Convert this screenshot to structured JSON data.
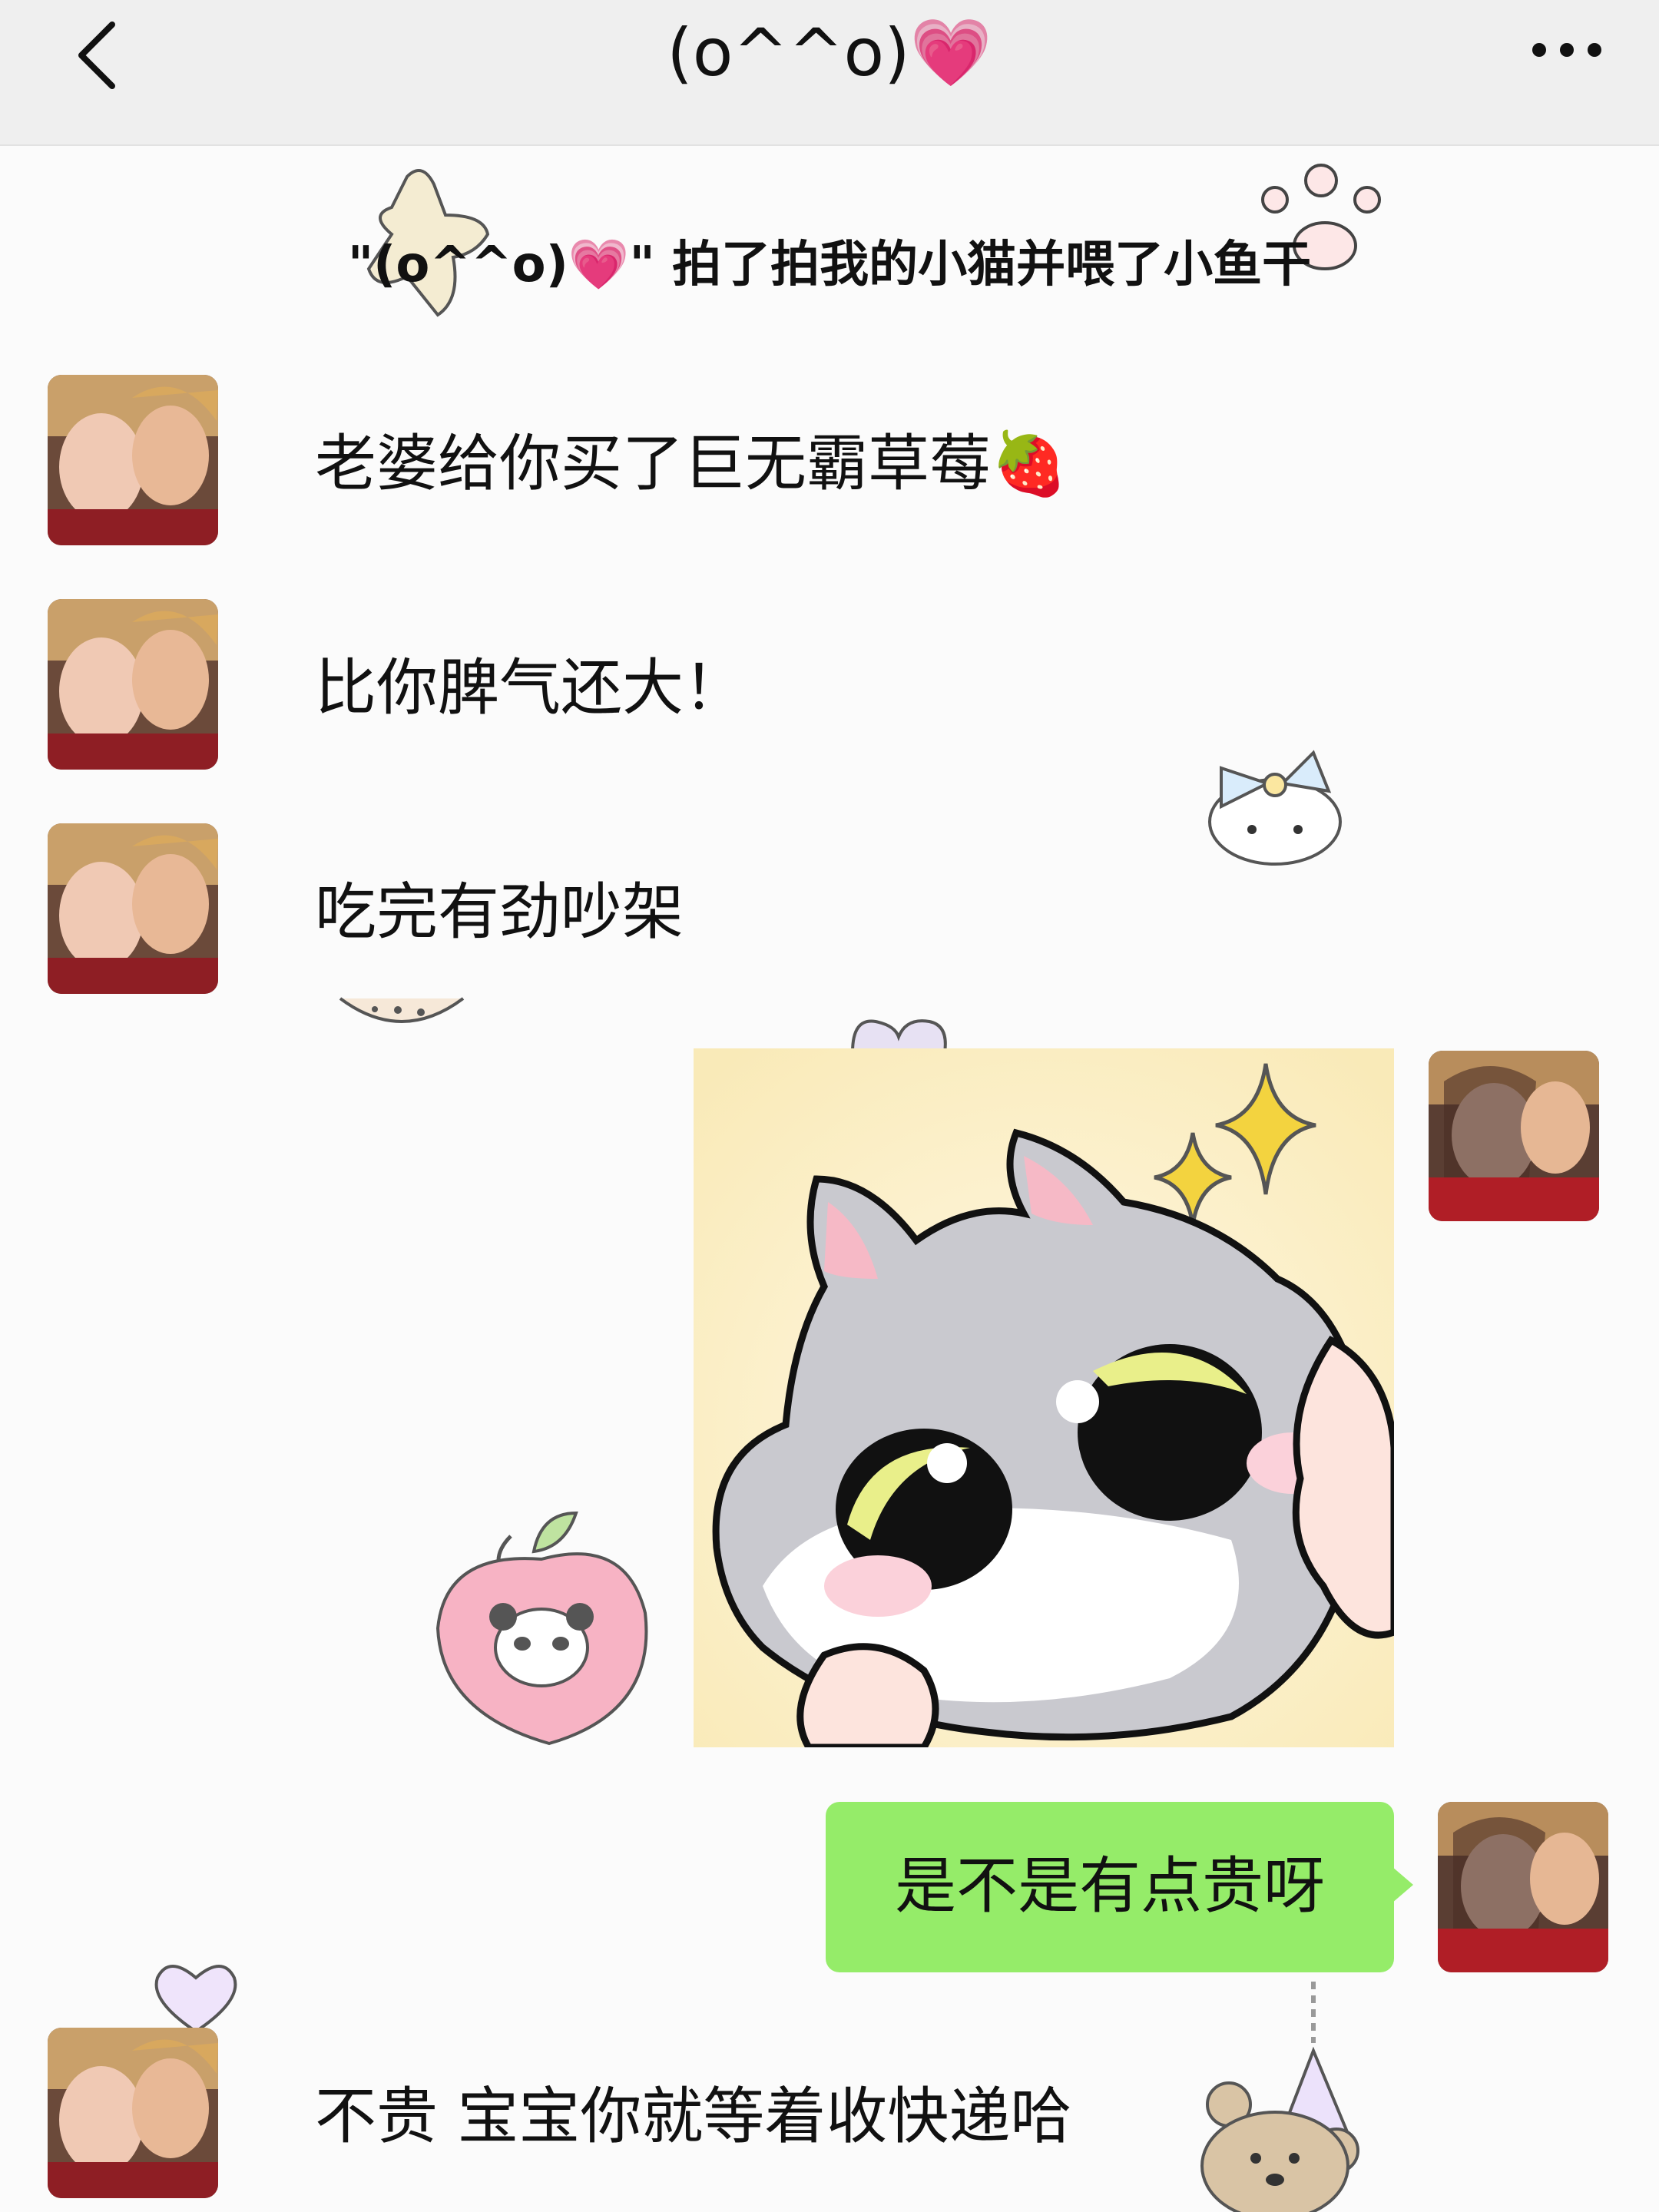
{
  "header": {
    "title": "(o^^o)💗",
    "back_icon": "chevron-left-icon",
    "more_icon": "more-dots-icon"
  },
  "system_message": "\"(o^^o)💗\" 拍了拍我的小猫并喂了小鱼干",
  "messages": [
    {
      "side": "left",
      "type": "text",
      "text": "老婆给你买了巨无霸草莓🍓"
    },
    {
      "side": "left",
      "type": "text",
      "text": "比你脾气还大！"
    },
    {
      "side": "left",
      "type": "text",
      "text": "吃完有劲吵架"
    },
    {
      "side": "right",
      "type": "sticker",
      "sticker": "gray-cat-sparkle-sticker"
    },
    {
      "side": "right",
      "type": "text",
      "text": "是不是有点贵呀"
    },
    {
      "side": "left",
      "type": "text",
      "text": "不贵 宝宝你就等着收快递哈"
    }
  ],
  "colors": {
    "header_bg": "#efefef",
    "chat_bg": "#fbfbfb",
    "outgoing_bubble": "#95ec69"
  }
}
